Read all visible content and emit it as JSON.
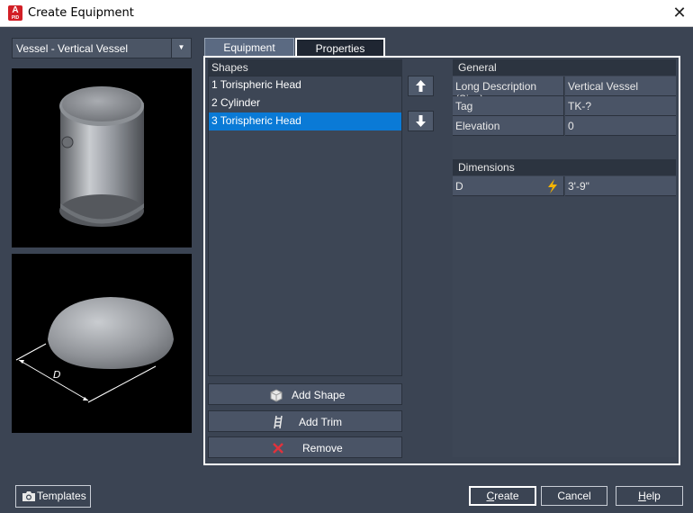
{
  "window": {
    "title": "Create Equipment",
    "app_icon_letter": "A",
    "app_icon_sub": "PID"
  },
  "equipment_type": {
    "selected": "Vessel - Vertical Vessel"
  },
  "tabs": [
    {
      "label": "Equipment"
    },
    {
      "label": "Properties"
    }
  ],
  "shapes": {
    "header": "Shapes",
    "items": [
      {
        "label": "1 Torispheric Head"
      },
      {
        "label": "2 Cylinder"
      },
      {
        "label": "3 Torispheric Head"
      }
    ],
    "selected_index": 2
  },
  "actions": {
    "add_shape": "Add Shape",
    "add_trim": "Add Trim",
    "remove": "Remove"
  },
  "properties": {
    "general_header": "General",
    "general": [
      {
        "key": "Long Description (Size)",
        "value": "Vertical Vessel"
      },
      {
        "key": "Tag",
        "value": "TK-?"
      },
      {
        "key": "Elevation",
        "value": "0"
      }
    ],
    "dimensions_header": "Dimensions",
    "dimensions": [
      {
        "key": "D",
        "value": "3'-9\""
      }
    ]
  },
  "preview": {
    "dimension_label": "D"
  },
  "buttons": {
    "templates": "Templates",
    "create_first": "C",
    "create_rest": "reate",
    "cancel": "Cancel",
    "help_first": "H",
    "help_rest": "elp"
  },
  "colors": {
    "selection": "#0a7ad6",
    "remove_icon": "#e0323c",
    "lightning": "#f5b400"
  }
}
